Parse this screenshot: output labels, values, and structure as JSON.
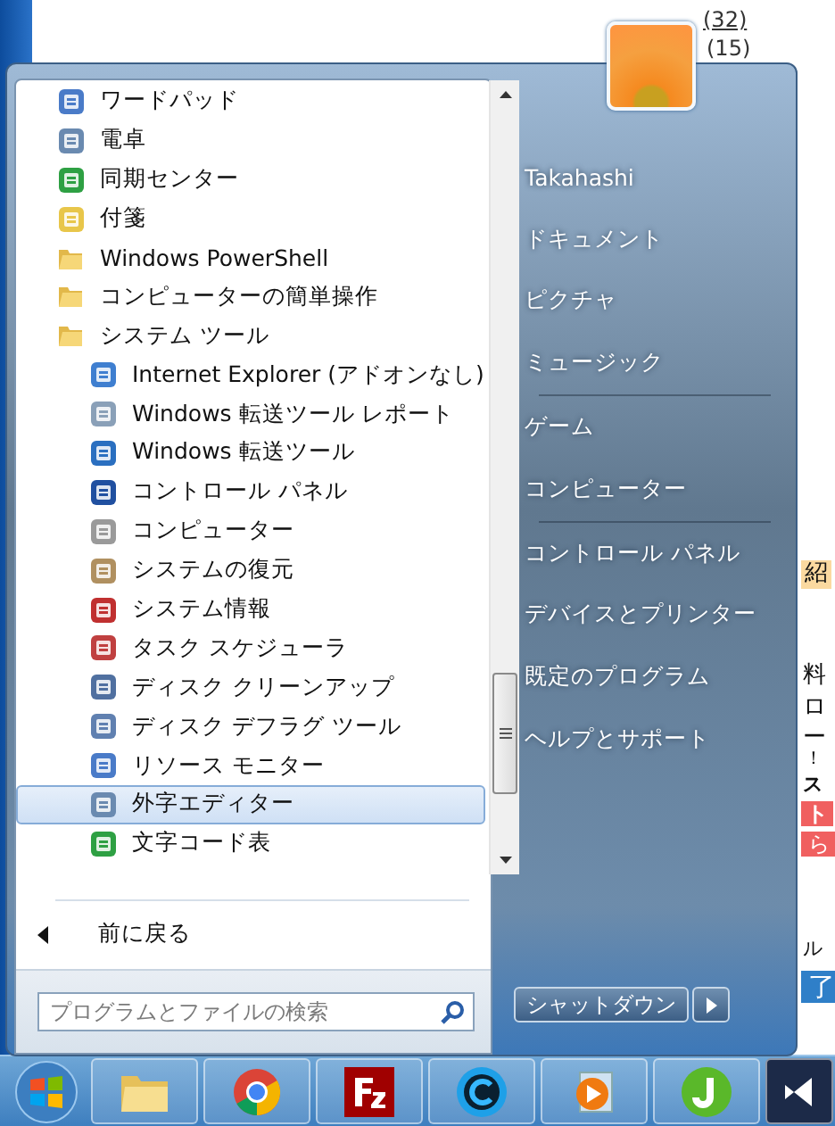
{
  "background_page": {
    "fragments": [
      {
        "text": "(32)"
      },
      {
        "text": "(15)"
      },
      {
        "text": "紹"
      },
      {
        "text": "料"
      },
      {
        "text": "ロ"
      },
      {
        "text": "ー"
      },
      {
        "text": "！"
      },
      {
        "text": "ス"
      },
      {
        "text": "ト"
      },
      {
        "text": "ら"
      },
      {
        "text": "ル"
      },
      {
        "text": "了"
      }
    ]
  },
  "start_menu": {
    "programs": [
      {
        "label": "ワードパッド",
        "kind": "app",
        "selected": false
      },
      {
        "label": "電卓",
        "kind": "app",
        "selected": false
      },
      {
        "label": "同期センター",
        "kind": "app",
        "selected": false
      },
      {
        "label": "付箋",
        "kind": "app",
        "selected": false
      },
      {
        "label": "Windows PowerShell",
        "kind": "folder",
        "selected": false
      },
      {
        "label": "コンピューターの簡単操作",
        "kind": "folder",
        "selected": false
      },
      {
        "label": "システム ツール",
        "kind": "folder",
        "selected": false,
        "children": [
          {
            "label": "Internet Explorer (アドオンなし)",
            "kind": "app",
            "selected": false
          },
          {
            "label": "Windows 転送ツール レポート",
            "kind": "app",
            "selected": false
          },
          {
            "label": "Windows 転送ツール",
            "kind": "app",
            "selected": false
          },
          {
            "label": "コントロール パネル",
            "kind": "app",
            "selected": false
          },
          {
            "label": "コンピューター",
            "kind": "app",
            "selected": false
          },
          {
            "label": "システムの復元",
            "kind": "app",
            "selected": false
          },
          {
            "label": "システム情報",
            "kind": "app",
            "selected": false
          },
          {
            "label": "タスク スケジューラ",
            "kind": "app",
            "selected": false
          },
          {
            "label": "ディスク クリーンアップ",
            "kind": "app",
            "selected": false
          },
          {
            "label": "ディスク デフラグ ツール",
            "kind": "app",
            "selected": false
          },
          {
            "label": "リソース モニター",
            "kind": "app",
            "selected": false
          },
          {
            "label": "外字エディター",
            "kind": "app",
            "selected": true
          },
          {
            "label": "文字コード表",
            "kind": "app",
            "selected": false
          }
        ]
      }
    ],
    "back_link": "前に戻る",
    "search": {
      "placeholder": "プログラムとファイルの検索"
    },
    "places": [
      [
        {
          "label": "Takahashi"
        },
        {
          "label": "ドキュメント"
        },
        {
          "label": "ピクチャ"
        },
        {
          "label": "ミュージック"
        }
      ],
      [
        {
          "label": "ゲーム"
        },
        {
          "label": "コンピューター"
        }
      ],
      [
        {
          "label": "コントロール パネル"
        },
        {
          "label": "デバイスとプリンター"
        },
        {
          "label": "既定のプログラム"
        },
        {
          "label": "ヘルプとサポート"
        }
      ]
    ],
    "shutdown": {
      "label": "シャットダウン"
    }
  }
}
